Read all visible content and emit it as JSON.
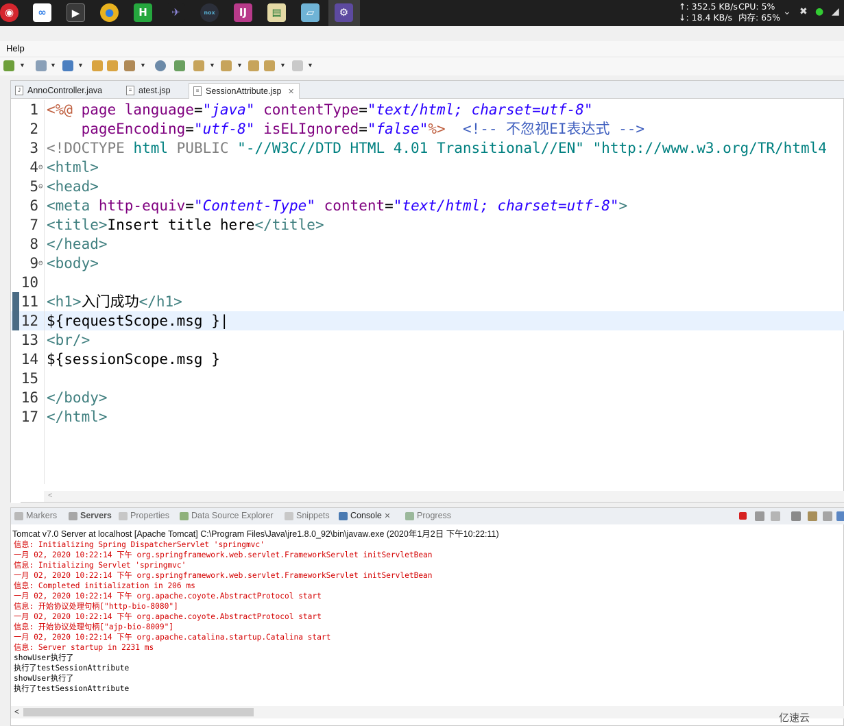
{
  "taskbar": {
    "net_up": "↑: 352.5 KB/s",
    "net_down": "↓: 18.4 KB/s",
    "cpu": "CPU: 5%",
    "mem": "内存: 65%"
  },
  "menu": {
    "help": "Help"
  },
  "editor_tabs": [
    {
      "label": "AnnoController.java"
    },
    {
      "label": "atest.jsp"
    },
    {
      "label": "SessionAttribute.jsp",
      "close": "✕"
    }
  ],
  "code_lines": [
    {
      "n": "1",
      "segments": [
        [
          "c-jsp",
          "<%@ "
        ],
        [
          "c-attr",
          "page language"
        ],
        [
          "c-txt",
          "="
        ],
        [
          "c-val",
          "\"java\""
        ],
        [
          "c-txt",
          " "
        ],
        [
          "c-attr",
          "contentType"
        ],
        [
          "c-txt",
          "="
        ],
        [
          "c-val",
          "\"text/html; charset=utf-8\""
        ]
      ]
    },
    {
      "n": "2",
      "segments": [
        [
          "c-txt",
          "    "
        ],
        [
          "c-attr",
          "pageEncoding"
        ],
        [
          "c-txt",
          "="
        ],
        [
          "c-val",
          "\"utf-8\""
        ],
        [
          "c-txt",
          " "
        ],
        [
          "c-attr",
          "isELIgnored"
        ],
        [
          "c-txt",
          "="
        ],
        [
          "c-val",
          "\"false\""
        ],
        [
          "c-jsp",
          "%>"
        ],
        [
          "c-txt",
          "  "
        ],
        [
          "c-com",
          "<!-- 不忽视EI表达式 -->"
        ]
      ]
    },
    {
      "n": "3",
      "segments": [
        [
          "c-gray",
          "<!DOCTYPE "
        ],
        [
          "c-doc",
          "html "
        ],
        [
          "c-gray",
          "PUBLIC "
        ],
        [
          "c-doc",
          "\"-//W3C//DTD HTML 4.01 Transitional//EN\" \"http://www.w3.org/TR/html4"
        ]
      ]
    },
    {
      "n": "4",
      "fold": "⊖",
      "segments": [
        [
          "c-tag",
          "<html>"
        ]
      ]
    },
    {
      "n": "5",
      "fold": "⊖",
      "segments": [
        [
          "c-tag",
          "<head>"
        ]
      ]
    },
    {
      "n": "6",
      "segments": [
        [
          "c-tag",
          "<meta "
        ],
        [
          "c-attr",
          "http-equiv"
        ],
        [
          "c-txt",
          "="
        ],
        [
          "c-val",
          "\"Content-Type\""
        ],
        [
          "c-txt",
          " "
        ],
        [
          "c-attr",
          "content"
        ],
        [
          "c-txt",
          "="
        ],
        [
          "c-val",
          "\"text/html; charset=utf-8\""
        ],
        [
          "c-tag",
          ">"
        ]
      ]
    },
    {
      "n": "7",
      "segments": [
        [
          "c-tag",
          "<title>"
        ],
        [
          "c-txt",
          "Insert title here"
        ],
        [
          "c-tag",
          "</title>"
        ]
      ]
    },
    {
      "n": "8",
      "segments": [
        [
          "c-tag",
          "</head>"
        ]
      ]
    },
    {
      "n": "9",
      "fold": "⊖",
      "segments": [
        [
          "c-tag",
          "<body>"
        ]
      ]
    },
    {
      "n": "10",
      "segments": []
    },
    {
      "n": "11",
      "segments": [
        [
          "c-tag",
          "<h1>"
        ],
        [
          "c-txt",
          "入门成功"
        ],
        [
          "c-tag",
          "</h1>"
        ]
      ]
    },
    {
      "n": "12",
      "segments": [
        [
          "c-txt",
          "${requestScope.msg }"
        ]
      ]
    },
    {
      "n": "13",
      "segments": [
        [
          "c-tag",
          "<br/>"
        ]
      ]
    },
    {
      "n": "14",
      "segments": [
        [
          "c-txt",
          "${sessionScope.msg }"
        ]
      ]
    },
    {
      "n": "15",
      "segments": []
    },
    {
      "n": "16",
      "segments": [
        [
          "c-tag",
          "</body>"
        ]
      ]
    },
    {
      "n": "17",
      "segments": [
        [
          "c-tag",
          "</html>"
        ]
      ]
    }
  ],
  "scroll_left_glyph": "<",
  "console_tabs": [
    {
      "label": "Markers"
    },
    {
      "label": "Servers"
    },
    {
      "label": "Properties"
    },
    {
      "label": "Data Source Explorer"
    },
    {
      "label": "Snippets"
    },
    {
      "label": "Console",
      "close": "✕"
    },
    {
      "label": "Progress"
    }
  ],
  "console_header": "Tomcat v7.0 Server at localhost [Apache Tomcat] C:\\Program Files\\Java\\jre1.8.0_92\\bin\\javaw.exe (2020年1月2日 下午10:22:11)",
  "console_lines": [
    {
      "text": "信息: Initializing Spring DispatcherServlet 'springmvc'",
      "color": "red"
    },
    {
      "text": "一月 02, 2020 10:22:14 下午 org.springframework.web.servlet.FrameworkServlet initServletBean",
      "color": "red"
    },
    {
      "text": "信息: Initializing Servlet 'springmvc'",
      "color": "red"
    },
    {
      "text": "一月 02, 2020 10:22:14 下午 org.springframework.web.servlet.FrameworkServlet initServletBean",
      "color": "red"
    },
    {
      "text": "信息: Completed initialization in 206 ms",
      "color": "red"
    },
    {
      "text": "一月 02, 2020 10:22:14 下午 org.apache.coyote.AbstractProtocol start",
      "color": "red"
    },
    {
      "text": "信息: 开始协议处理句柄[\"http-bio-8080\"]",
      "color": "red"
    },
    {
      "text": "一月 02, 2020 10:22:14 下午 org.apache.coyote.AbstractProtocol start",
      "color": "red"
    },
    {
      "text": "信息: 开始协议处理句柄[\"ajp-bio-8009\"]",
      "color": "red"
    },
    {
      "text": "一月 02, 2020 10:22:14 下午 org.apache.catalina.startup.Catalina start",
      "color": "red"
    },
    {
      "text": "信息: Server startup in 2231 ms",
      "color": "red"
    },
    {
      "text": "showUser执行了",
      "color": "black"
    },
    {
      "text": "执行了testSessionAttribute",
      "color": "black"
    },
    {
      "text": "showUser执行了",
      "color": "black"
    },
    {
      "text": "执行了testSessionAttribute",
      "color": "black"
    }
  ],
  "watermark": "亿速云"
}
